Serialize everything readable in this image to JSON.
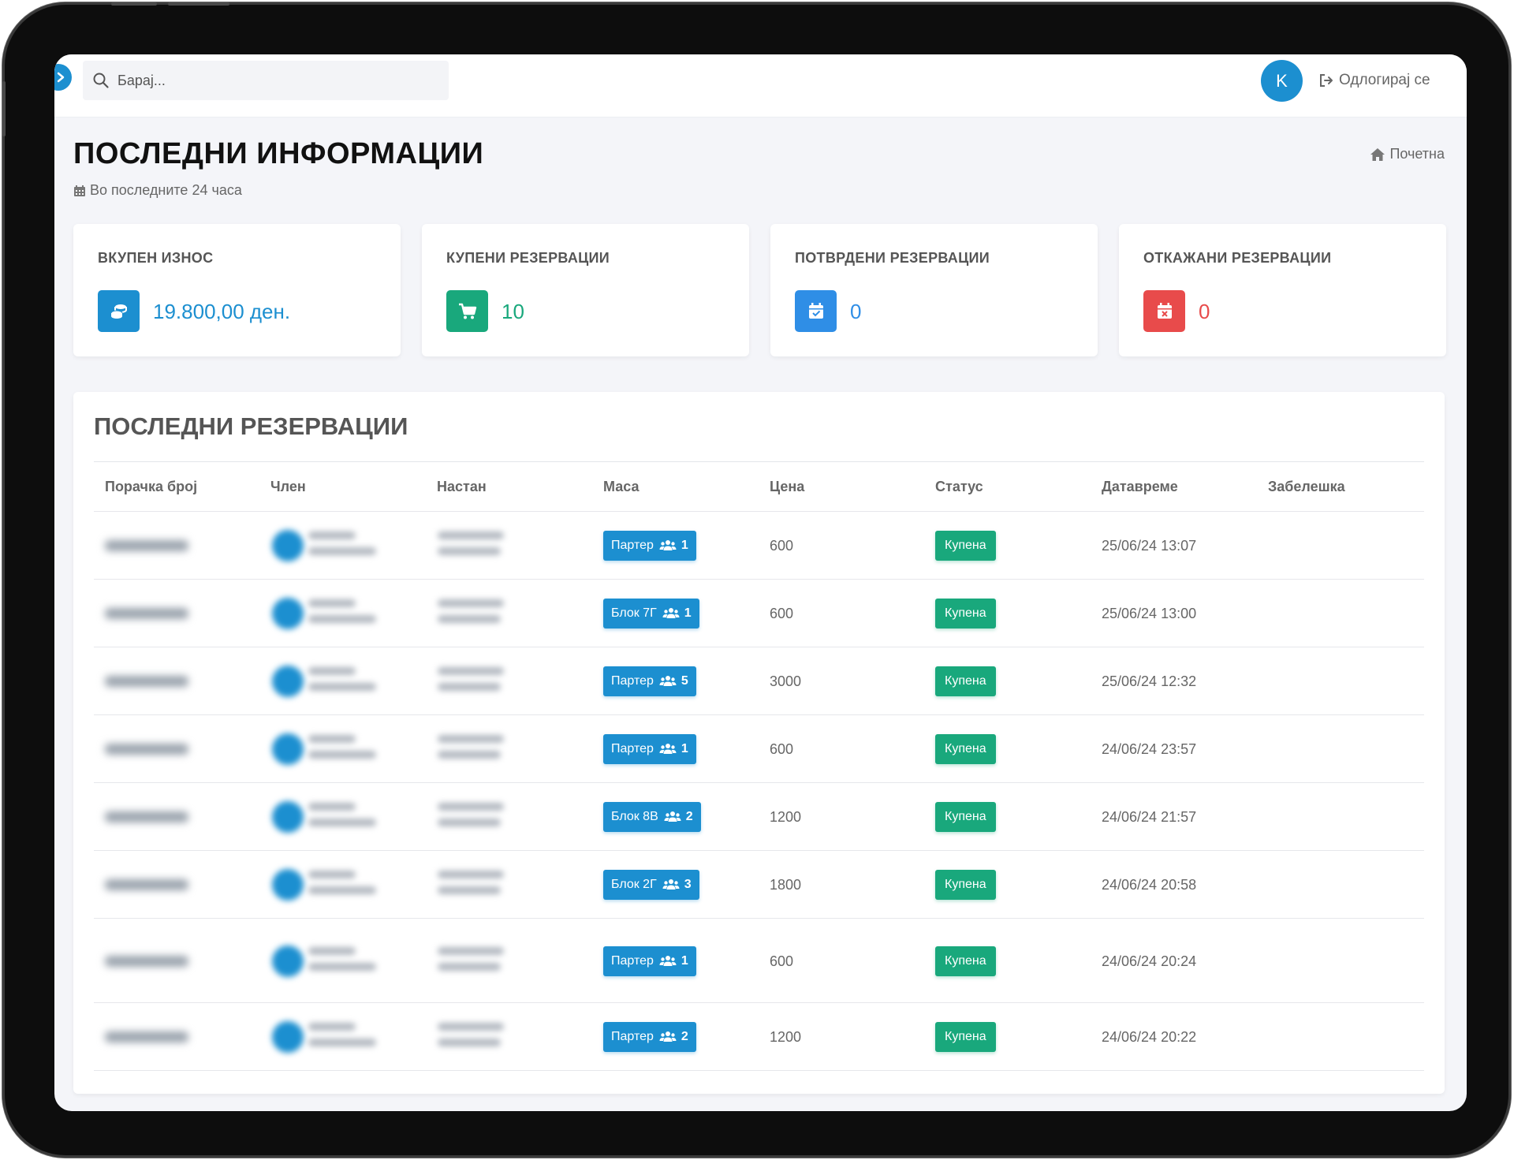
{
  "search": {
    "placeholder": "Барај..."
  },
  "user": {
    "initial": "K"
  },
  "logout_label": "Одлогирај се",
  "page": {
    "title": "ПОСЛЕДНИ ИНФОРМАЦИИ",
    "subtitle": "Во последните 24 часа",
    "breadcrumb_home": "Почетна"
  },
  "stats": [
    {
      "title": "ВКУПЕН ИЗНОС",
      "value": "19.800,00 ден.",
      "icon": "coins-icon",
      "color": "#1c8fd0"
    },
    {
      "title": "КУПЕНИ РЕЗЕРВАЦИИ",
      "value": "10",
      "icon": "cart-icon",
      "color": "#19a87c"
    },
    {
      "title": "ПОТВРДЕНИ РЕЗЕРВАЦИИ",
      "value": "0",
      "icon": "calendar-check-icon",
      "color": "#2f8ee6"
    },
    {
      "title": "ОТКАЖАНИ РЕЗЕРВАЦИИ",
      "value": "0",
      "icon": "calendar-x-icon",
      "color": "#e84b4b"
    }
  ],
  "reservations": {
    "title": "ПОСЛЕДНИ РЕЗЕРВАЦИИ",
    "columns": [
      "Порачка број",
      "Член",
      "Настан",
      "Маса",
      "Цена",
      "Статус",
      "Датавреме",
      "Забелешка"
    ],
    "rows": [
      {
        "table": "Партер",
        "seats": "1",
        "price": "600",
        "status": "Купена",
        "datetime": "25/06/24 13:07",
        "note": ""
      },
      {
        "table": "Блок 7Г",
        "seats": "1",
        "price": "600",
        "status": "Купена",
        "datetime": "25/06/24 13:00",
        "note": ""
      },
      {
        "table": "Партер",
        "seats": "5",
        "price": "3000",
        "status": "Купена",
        "datetime": "25/06/24 12:32",
        "note": ""
      },
      {
        "table": "Партер",
        "seats": "1",
        "price": "600",
        "status": "Купена",
        "datetime": "24/06/24 23:57",
        "note": ""
      },
      {
        "table": "Блок 8В",
        "seats": "2",
        "price": "1200",
        "status": "Купена",
        "datetime": "24/06/24 21:57",
        "note": ""
      },
      {
        "table": "Блок 2Г",
        "seats": "3",
        "price": "1800",
        "status": "Купена",
        "datetime": "24/06/24 20:58",
        "note": ""
      },
      {
        "table": "Партер",
        "seats": "1",
        "price": "600",
        "status": "Купена",
        "datetime": "24/06/24 20:24",
        "note": ""
      },
      {
        "table": "Партер",
        "seats": "2",
        "price": "1200",
        "status": "Купена",
        "datetime": "24/06/24 20:22",
        "note": ""
      }
    ]
  }
}
